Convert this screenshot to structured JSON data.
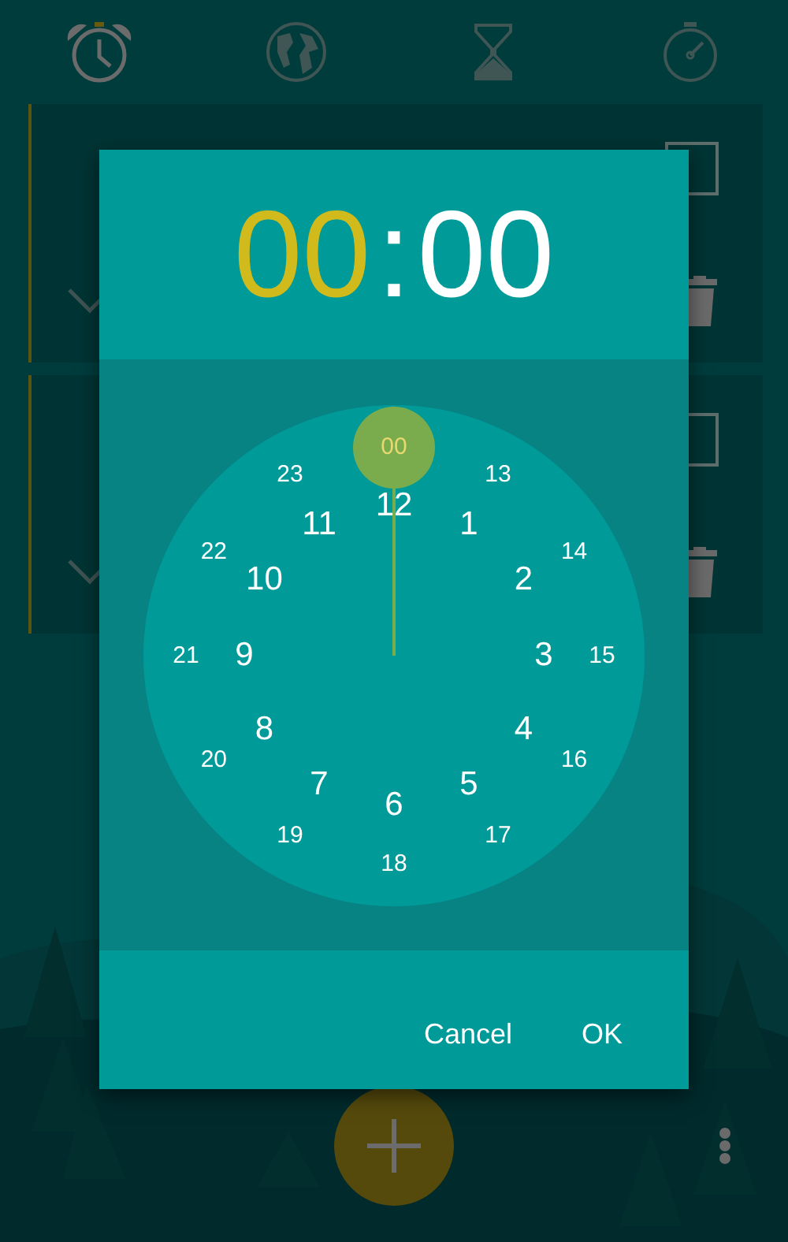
{
  "tabs": [
    {
      "kind": "alarm",
      "selected": true
    },
    {
      "kind": "globe",
      "selected": false
    },
    {
      "kind": "hourglass",
      "selected": false
    },
    {
      "kind": "stopwatch",
      "selected": false
    }
  ],
  "alarm_cards": [
    {
      "checked": false
    },
    {
      "checked": false
    }
  ],
  "dialog": {
    "time": [
      {
        "kind": "hours",
        "text": "00",
        "selected": true
      },
      {
        "kind": "separator",
        "text": ":"
      },
      {
        "kind": "minutes",
        "text": "00",
        "selected": false
      }
    ],
    "inner_ring": [
      {
        "label": "12",
        "selected": false
      },
      {
        "label": "1",
        "selected": false
      },
      {
        "label": "2",
        "selected": false
      },
      {
        "label": "3",
        "selected": false
      },
      {
        "label": "4",
        "selected": false
      },
      {
        "label": "5",
        "selected": false
      },
      {
        "label": "6",
        "selected": false
      },
      {
        "label": "7",
        "selected": false
      },
      {
        "label": "8",
        "selected": false
      },
      {
        "label": "9",
        "selected": false
      },
      {
        "label": "10",
        "selected": false
      },
      {
        "label": "11",
        "selected": false
      }
    ],
    "outer_ring": [
      {
        "label": "00",
        "selected": true
      },
      {
        "label": "13",
        "selected": false
      },
      {
        "label": "14",
        "selected": false
      },
      {
        "label": "15",
        "selected": false
      },
      {
        "label": "16",
        "selected": false
      },
      {
        "label": "17",
        "selected": false
      },
      {
        "label": "18",
        "selected": false
      },
      {
        "label": "19",
        "selected": false
      },
      {
        "label": "20",
        "selected": false
      },
      {
        "label": "21",
        "selected": false
      },
      {
        "label": "22",
        "selected": false
      },
      {
        "label": "23",
        "selected": false
      }
    ],
    "buttons": [
      "Cancel",
      "OK"
    ]
  }
}
